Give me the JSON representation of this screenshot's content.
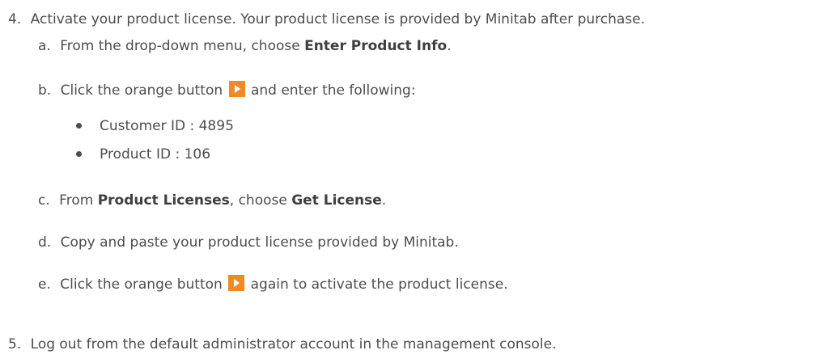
{
  "step4": {
    "number": "4.",
    "text": "Activate your product license. Your product license is provided by Minitab after purchase.",
    "substeps": {
      "a": {
        "letter": "a.",
        "pre": "From the drop-down menu, choose ",
        "bold": "Enter Product Info",
        "post": "."
      },
      "b": {
        "letter": "b.",
        "pre": "Click the orange button ",
        "post": " and enter the following:",
        "bullets": [
          "Customer ID : 4895",
          "Product ID : 106"
        ]
      },
      "c": {
        "letter": "c.",
        "pre": "From ",
        "bold1": "Product Licenses",
        "mid": ", choose ",
        "bold2": "Get License",
        "post": "."
      },
      "d": {
        "letter": "d.",
        "text": "Copy and paste your product license provided by Minitab."
      },
      "e": {
        "letter": "e.",
        "pre": "Click the orange button ",
        "post": " again to activate the product license."
      }
    }
  },
  "step5": {
    "number": "5.",
    "text": "Log out from the default administrator account in the management console."
  },
  "colors": {
    "accent": "#f08a24",
    "text": "#4d4d4d"
  },
  "icons": {
    "orange_button": "play-arrow-icon"
  }
}
